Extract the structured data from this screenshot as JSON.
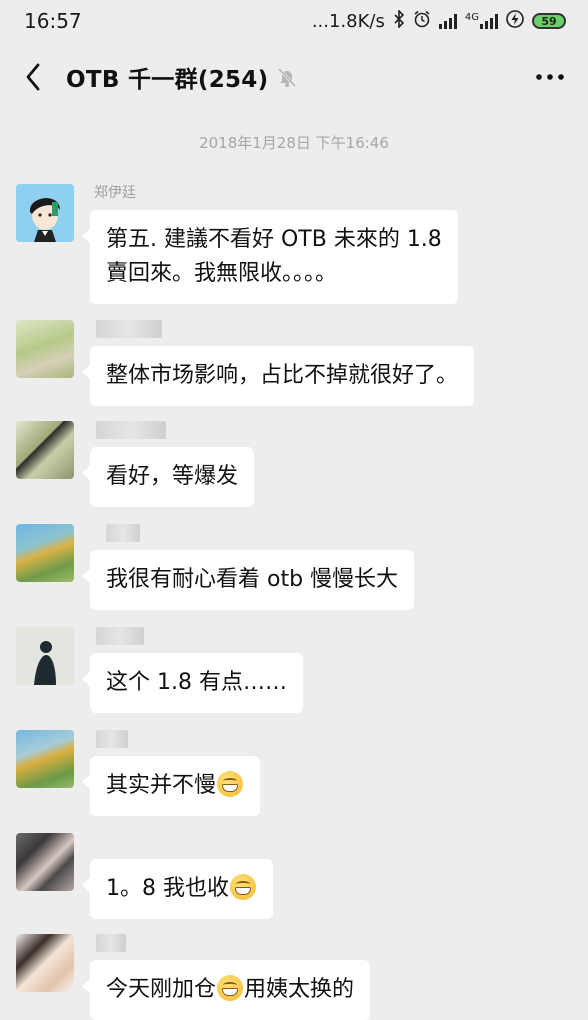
{
  "status_bar": {
    "time": "16:57",
    "network_speed": "...1.8K/s",
    "network_type": "4G",
    "battery": "59"
  },
  "header": {
    "title": "OTB 千一群(254)"
  },
  "chat": {
    "timestamp": "2018年1月28日 下午16:46",
    "messages": [
      {
        "sender": "郑伊廷",
        "text": "第五. 建議不看好 OTB 未來的 1.8\n賣回來。我無限收。。。。"
      },
      {
        "sender": "",
        "text": "整体市场影响，占比不掉就很好了。"
      },
      {
        "sender": "",
        "text": "看好，等爆发"
      },
      {
        "sender": "",
        "text": "我很有耐心看着 otb 慢慢长大"
      },
      {
        "sender": "",
        "text": "这个 1.8 有点……"
      },
      {
        "sender": "",
        "text_before": "其实并不慢",
        "emoji": "grin"
      },
      {
        "sender": "",
        "text_before": "1。8 我也收",
        "emoji": "grin"
      },
      {
        "sender": "",
        "text_before": "今天刚加仓",
        "emoji": "grin",
        "text_after": "用姨太换的"
      }
    ]
  },
  "colors": {
    "background": "#ededed",
    "bubble": "#ffffff",
    "timestamp": "#a6a6a6"
  }
}
